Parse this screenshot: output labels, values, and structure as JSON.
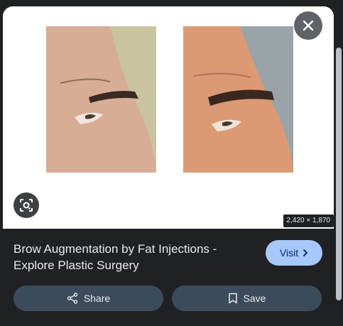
{
  "preview": {
    "dimensions": "2,420 × 1,870",
    "images": [
      {
        "description_icon": "before-photo"
      },
      {
        "description_icon": "after-photo"
      }
    ]
  },
  "buttons": {
    "close_icon": "close-icon",
    "lens_icon": "lens-icon"
  },
  "result": {
    "title": "Brow Augmentation by Fat Injections - Explore Plastic Surgery",
    "visit_label": "Visit",
    "share_label": "Share",
    "save_label": "Save"
  },
  "colors": {
    "background": "#202124",
    "visit_bg": "#a8c7fa",
    "action_bg": "#3c4b5c"
  }
}
